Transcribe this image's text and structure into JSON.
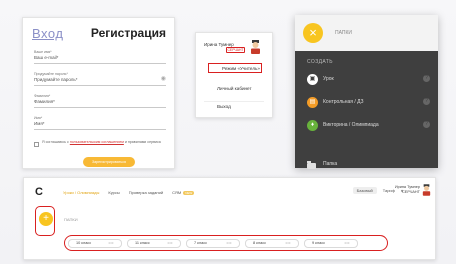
{
  "registration": {
    "tab_login": "Вход",
    "tab_register": "Регистрация",
    "fields": [
      {
        "label": "Ваше имя*",
        "placeholder": "Ваш e-mail*"
      },
      {
        "label": "Придумайте пароль*",
        "placeholder": "Придумайте пароль*"
      },
      {
        "label": "Фамилия*",
        "placeholder": "Фамилия*"
      },
      {
        "label": "Имя*",
        "placeholder": "Имя*"
      }
    ],
    "terms_prefix": "Я соглашаюсь с",
    "terms_link": "пользовательским соглашением",
    "terms_suffix": "и правилами сервиса",
    "submit": "Зарегистрироваться"
  },
  "profile": {
    "name": "Ирина Тумнер",
    "role": "СЕРЧАНТ",
    "menu": [
      {
        "icon": "",
        "label": "Режим «Учитель»"
      },
      {
        "icon": "",
        "label": "Личный кабинет"
      },
      {
        "icon": "",
        "label": "Выход"
      }
    ]
  },
  "create_menu": {
    "fab_glyph": "×",
    "title": "ПАПКИ",
    "section": "СОЗДАТЬ",
    "items": [
      {
        "label": "Урок",
        "color": "#ffffff"
      },
      {
        "label": "Контрольная / ДЗ",
        "color": "#f39c27"
      },
      {
        "label": "Викторина / Олимпиада",
        "color": "#68b23c"
      }
    ],
    "folder_label": "Папка"
  },
  "dashboard": {
    "logo": "С",
    "nav": [
      "Уроки / Олимпиады",
      "Курсы",
      "Проверка заданий",
      "СЯМ"
    ],
    "nav_badge": "NEW",
    "plan_badge": "Базовый",
    "plan_label": "Тариф",
    "bell_icon": "♦",
    "user_name": "Ирина Тумнер",
    "user_role": "СЕРЧАНТ",
    "fab_glyph": "+",
    "folders_label": "ПАПКИ",
    "grades": [
      "10 класс",
      "11 класс",
      "7 класс",
      "8 класс",
      "9 класс"
    ],
    "grade_menu": "•••"
  },
  "colors": {
    "accent_yellow": "#f8c520",
    "highlight_red": "#d92020",
    "dark_panel": "#3f3f3f"
  }
}
